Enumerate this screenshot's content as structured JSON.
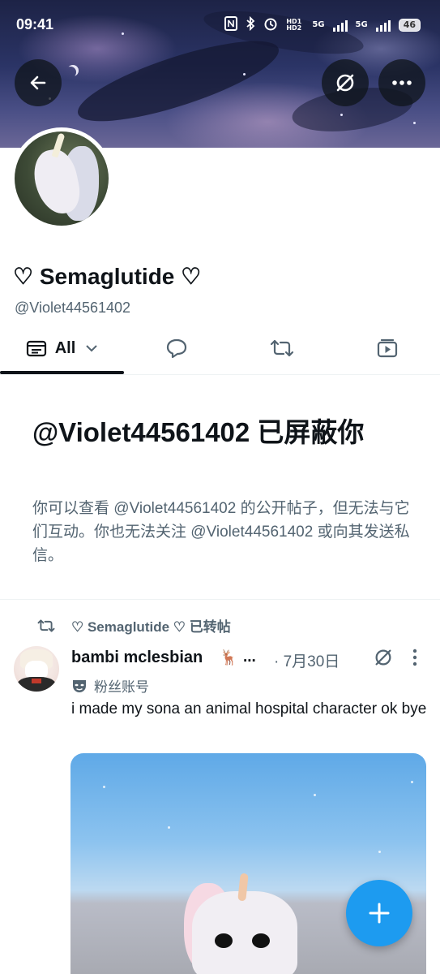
{
  "status_bar": {
    "time": "09:41",
    "network_1": "5G",
    "network_2": "5G",
    "hd_label": "HD1 HD2",
    "battery": "46"
  },
  "profile": {
    "display_name": "♡ Semaglutide ♡",
    "handle": "@Violet44561402"
  },
  "tabs": [
    {
      "label": "All",
      "icon": "posts-icon",
      "selected": true
    },
    {
      "label": "",
      "icon": "reply-icon"
    },
    {
      "label": "",
      "icon": "repost-icon"
    },
    {
      "label": "",
      "icon": "media-icon"
    }
  ],
  "blocked": {
    "title": "@Violet44561402 已屏蔽你",
    "body": "你可以查看 @Violet44561402 的公开帖子，但无法与它们互动。你也无法关注 @Violet44561402 或向其发送私信。"
  },
  "post": {
    "repost_label": "♡ Semaglutide ♡ 已转帖",
    "author": "bambi mclesbian",
    "author_emoji": "🦌",
    "truncation": "...",
    "date": "· 7月30日",
    "badge_label": "粉丝账号",
    "text": "i made my sona an animal hospital character ok bye"
  },
  "colors": {
    "accent": "#1d9bf0",
    "text_primary": "#0f1419",
    "text_secondary": "#536471"
  }
}
